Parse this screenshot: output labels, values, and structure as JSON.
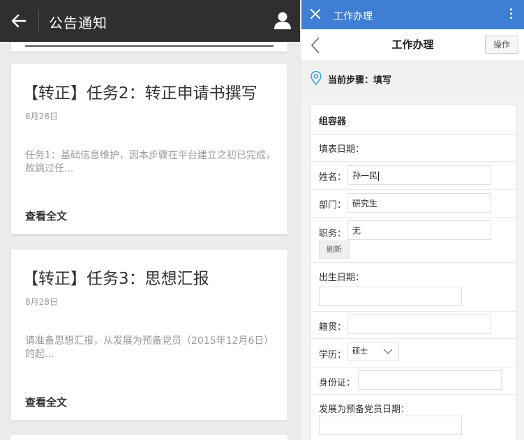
{
  "left": {
    "header": {
      "title": "公告通知",
      "back_icon": "arrow-left-icon",
      "user_icon": "user-icon"
    },
    "notices": [
      {
        "title": "【转正】任务2：转正申请书撰写",
        "date": "8月28日",
        "excerpt": "任务1：基础信息维护，因本步骤在平台建立之初已完成，故跳过任...",
        "read_more": "查看全文"
      },
      {
        "title": "【转正】任务3：思想汇报",
        "date": "8月28日",
        "excerpt": "请准备思想汇报，从发展为预备党员（2015年12月6日）的起...",
        "read_more": "查看全文"
      }
    ]
  },
  "right": {
    "appbar": {
      "title": "工作办理",
      "close_icon": "close-icon",
      "menu_icon": "more-vertical-icon"
    },
    "nav": {
      "title": "工作办理",
      "operate_label": "操作",
      "back_icon": "chevron-left-icon"
    },
    "step": {
      "label": "当前步骤：填写",
      "icon": "location-pin-icon"
    },
    "form": {
      "section_title": "组容器",
      "fill_date_label": "填表日期：",
      "name_label": "姓名：",
      "name_value": "孙一民",
      "dept_label": "部门：",
      "dept_value": "研究生",
      "position_label": "职务：",
      "position_value": "无",
      "refresh_label": "刷新",
      "birth_label": "出生日期：",
      "birth_value": "",
      "origin_label": "籍贯：",
      "origin_value": "",
      "edu_label": "学历：",
      "edu_value": "硕士",
      "id_label": "身份证：",
      "id_value": "",
      "prep_date_label": "发展为预备党员日期：",
      "prep_date_value": ""
    }
  },
  "colors": {
    "left_header_bg": "#2f2f2f",
    "right_appbar_bg": "#3e7fd3",
    "page_bg": "#ebebeb"
  }
}
